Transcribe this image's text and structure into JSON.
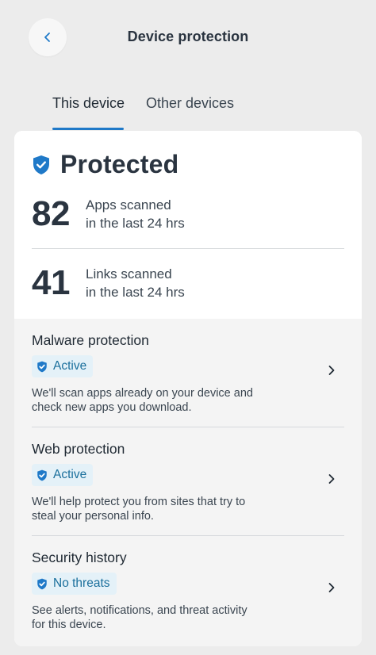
{
  "header": {
    "title": "Device protection",
    "back_icon": "chevron-left-icon"
  },
  "tabs": [
    {
      "label": "This device",
      "active": true
    },
    {
      "label": "Other devices",
      "active": false
    }
  ],
  "summary": {
    "status": "Protected",
    "status_icon": "shield-check-icon",
    "stats": [
      {
        "value": "82",
        "label_line1": "Apps scanned",
        "label_line2": "in the last 24 hrs"
      },
      {
        "value": "41",
        "label_line1": "Links scanned",
        "label_line2": "in the last 24 hrs"
      }
    ]
  },
  "features": [
    {
      "title": "Malware protection",
      "badge": "Active",
      "desc_line1": "We'll scan apps already on your device and",
      "desc_line2": "check new apps you download."
    },
    {
      "title": "Web protection",
      "badge": "Active",
      "desc_line1": "We'll help protect you from sites that try to",
      "desc_line2": "steal your personal info."
    },
    {
      "title": "Security history",
      "badge": "No threats",
      "desc_line1": "See alerts, notifications, and threat activity",
      "desc_line2": "for this device."
    }
  ],
  "colors": {
    "accent": "#1f79c8",
    "badge_bg": "#e4f1f8",
    "badge_text": "#1a6f9c",
    "shield": "#1f79c8"
  }
}
